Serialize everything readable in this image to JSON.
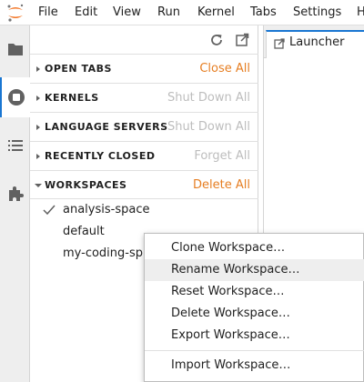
{
  "menubar": {
    "items": [
      "File",
      "Edit",
      "View",
      "Run",
      "Kernel",
      "Tabs",
      "Settings",
      "H"
    ]
  },
  "activity_bar": {
    "icons": [
      "folder-icon",
      "running-icon",
      "toc-icon",
      "extension-icon"
    ],
    "active": "running-icon"
  },
  "panel": {
    "sections": [
      {
        "title": "OPEN TABS",
        "action": "Close All",
        "action_enabled": true,
        "expanded": false
      },
      {
        "title": "KERNELS",
        "action": "Shut Down All",
        "action_enabled": false,
        "expanded": false
      },
      {
        "title": "LANGUAGE SERVERS",
        "action": "Shut Down All",
        "action_enabled": false,
        "expanded": false
      },
      {
        "title": "RECENTLY CLOSED",
        "action": "Forget All",
        "action_enabled": false,
        "expanded": false
      },
      {
        "title": "WORKSPACES",
        "action": "Delete All",
        "action_enabled": true,
        "expanded": true
      }
    ],
    "workspaces": [
      {
        "name": "analysis-space",
        "current": true
      },
      {
        "name": "default",
        "current": false
      },
      {
        "name": "my-coding-sp",
        "current": false
      }
    ]
  },
  "main": {
    "tab_label": "Launcher"
  },
  "context_menu": {
    "items": [
      {
        "label": "Clone Workspace…",
        "highlighted": false
      },
      {
        "label": "Rename Workspace…",
        "highlighted": true
      },
      {
        "label": "Reset Workspace…",
        "highlighted": false
      },
      {
        "label": "Delete Workspace…",
        "highlighted": false
      },
      {
        "label": "Export Workspace…",
        "highlighted": false
      },
      {
        "label": "Import Workspace…",
        "highlighted": false
      }
    ]
  },
  "colors": {
    "accent": "#e67e22",
    "disabled": "#bdbdbd",
    "brand": "#f37626",
    "icon": "#616161"
  }
}
